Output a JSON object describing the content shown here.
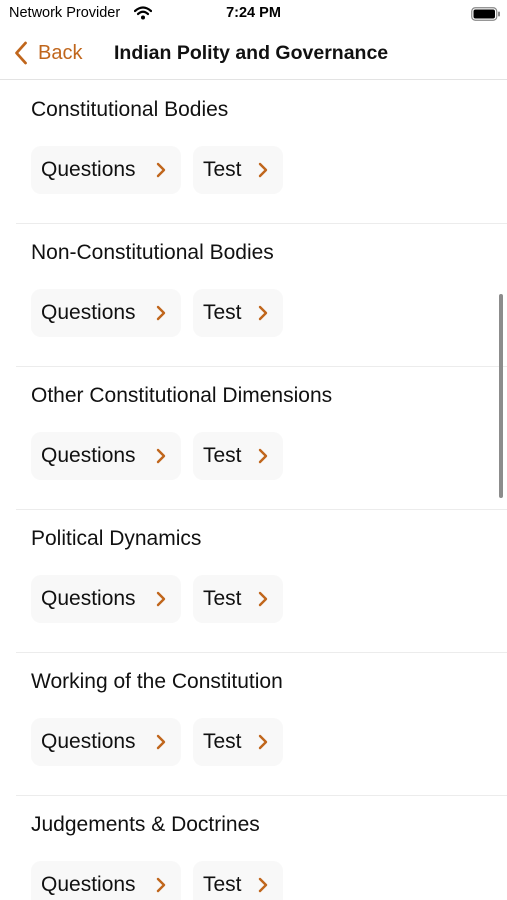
{
  "status_bar": {
    "carrier": "Network Provider",
    "time": "7:24 PM"
  },
  "nav": {
    "back_label": "Back",
    "title": "Indian Polity and Governance"
  },
  "accent_color": "#c0661c",
  "sections": [
    {
      "title": "Constitutional Bodies",
      "questions_label": "Questions",
      "test_label": "Test"
    },
    {
      "title": "Non-Constitutional Bodies",
      "questions_label": "Questions",
      "test_label": "Test"
    },
    {
      "title": "Other Constitutional Dimensions",
      "questions_label": "Questions",
      "test_label": "Test"
    },
    {
      "title": "Political Dynamics",
      "questions_label": "Questions",
      "test_label": "Test"
    },
    {
      "title": "Working of the Constitution",
      "questions_label": "Questions",
      "test_label": "Test"
    },
    {
      "title": "Judgements & Doctrines",
      "questions_label": "Questions",
      "test_label": "Test"
    }
  ]
}
